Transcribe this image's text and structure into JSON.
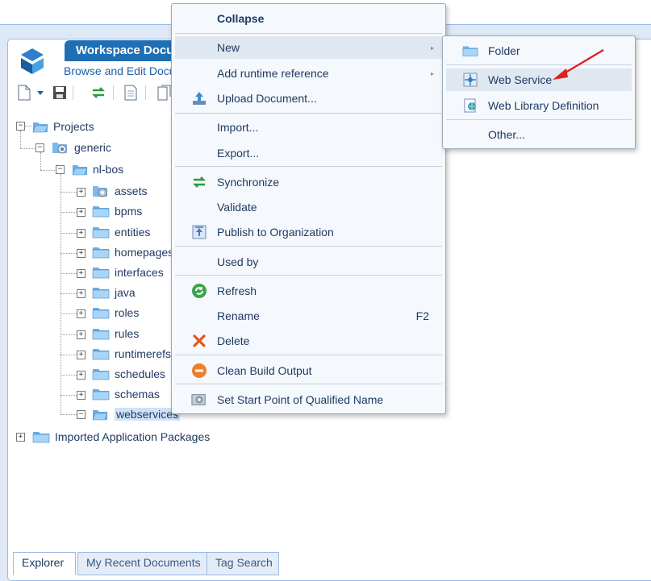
{
  "workspace": {
    "title": "Workspace Documents",
    "subtitle": "Browse and Edit Documents"
  },
  "toolbar": {
    "icons": [
      "new-document-icon",
      "dropdown-arrow-icon",
      "save-icon",
      "synchronize-icon",
      "document-icon",
      "export-icon"
    ]
  },
  "tree": {
    "root": "Projects",
    "project": "generic",
    "folder": "nl-bos",
    "children": [
      "assets",
      "bpms",
      "entities",
      "homepages",
      "interfaces",
      "java",
      "roles",
      "rules",
      "runtimerefs",
      "schedules",
      "schemas",
      "webservices"
    ],
    "selected": "webservices",
    "other_root": "Imported Application Packages"
  },
  "tabs": [
    "Explorer",
    "My Recent Documents",
    "Tag Search"
  ],
  "active_tab": "Explorer",
  "context_menu": {
    "collapse": "Collapse",
    "new": "New",
    "add_runtime_reference": "Add runtime reference",
    "upload_document": "Upload Document...",
    "import": "Import...",
    "export": "Export...",
    "synchronize": "Synchronize",
    "validate": "Validate",
    "publish": "Publish to Organization",
    "used_by": "Used by",
    "refresh": "Refresh",
    "rename": "Rename",
    "rename_shortcut": "F2",
    "delete": "Delete",
    "clean_build": "Clean Build Output",
    "set_start_point": "Set Start Point of Qualified Name"
  },
  "submenu": {
    "folder": "Folder",
    "web_service": "Web Service",
    "web_library_definition": "Web Library Definition",
    "other": "Other..."
  },
  "colors": {
    "accent": "#1f6fb5",
    "annotation_arrow": "#e02020",
    "selection": "#cfe2f6"
  }
}
